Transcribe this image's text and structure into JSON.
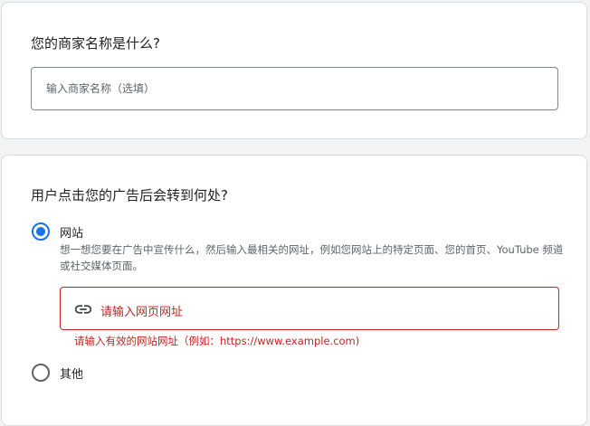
{
  "business": {
    "question": "您的商家名称是什么?",
    "input_placeholder": "输入商家名称（选填）"
  },
  "destination": {
    "question": "用户点击您的广告后会转到何处?",
    "options": [
      {
        "label": "网站",
        "selected": true,
        "description": "想一想您要在广告中宣传什么，然后输入最相关的网址，例如您网站上的特定页面、您的首页、YouTube 频道或社交媒体页面。",
        "url_placeholder": "请输入网页网址",
        "error": "请输入有效的网站网址（例如：https://www.example.com)"
      },
      {
        "label": "其他",
        "selected": false
      }
    ]
  },
  "icons": {
    "url_field": "link-icon"
  },
  "colors": {
    "accent": "#1a73e8",
    "error": "#c5221f"
  }
}
